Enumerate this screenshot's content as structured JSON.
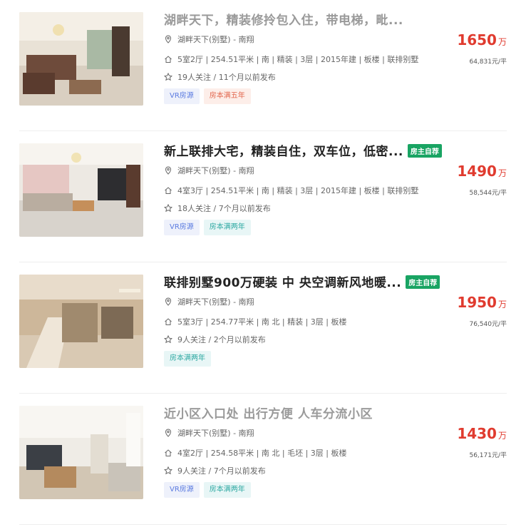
{
  "listings": [
    {
      "title": "湖畔天下，精装修拎包入住，带电梯，毗...",
      "owner_badge": "",
      "location": "湖畔天下(别墅) - 南翔",
      "info": "5室2厅 | 254.51平米 | 南 | 精装 | 3层 | 2015年建 | 板楼 | 联排别墅",
      "follow": "19人关注 / 11个月以前发布",
      "tags": [
        {
          "label": "VR房源",
          "kind": "vr"
        },
        {
          "label": "房本满五年",
          "kind": "five"
        }
      ],
      "total_price": "1650",
      "total_unit": "万",
      "unit_price": "64,831元/平"
    },
    {
      "title": "新上联排大宅，精装自住，双车位，低密...",
      "owner_badge": "房主自荐",
      "location": "湖畔天下(别墅) - 南翔",
      "info": "4室3厅 | 254.51平米 | 南 | 精装 | 3层 | 2015年建 | 板楼 | 联排别墅",
      "follow": "18人关注 / 7个月以前发布",
      "tags": [
        {
          "label": "VR房源",
          "kind": "vr"
        },
        {
          "label": "房本满两年",
          "kind": "two"
        }
      ],
      "total_price": "1490",
      "total_unit": "万",
      "unit_price": "58,544元/平"
    },
    {
      "title": "联排别墅900万硬装 中 央空调新风地暖...",
      "owner_badge": "房主自荐",
      "location": "湖畔天下(别墅) - 南翔",
      "info": "5室3厅 | 254.77平米 | 南 北 | 精装 | 3层 | 板楼",
      "follow": "9人关注 / 2个月以前发布",
      "tags": [
        {
          "label": "房本满两年",
          "kind": "two"
        }
      ],
      "total_price": "1950",
      "total_unit": "万",
      "unit_price": "76,540元/平"
    },
    {
      "title": "近小区入口处 出行方便 人车分流小区",
      "owner_badge": "",
      "location": "湖畔天下(别墅) - 南翔",
      "info": "4室2厅 | 254.58平米 | 南 北 | 毛坯 | 3层 | 板楼",
      "follow": "9人关注 / 7个月以前发布",
      "tags": [
        {
          "label": "VR房源",
          "kind": "vr"
        },
        {
          "label": "房本满两年",
          "kind": "two"
        }
      ],
      "total_price": "1430",
      "total_unit": "万",
      "unit_price": "56,171元/平"
    }
  ],
  "icons": {
    "location": "map-pin-icon",
    "info": "house-icon",
    "follow": "star-icon"
  },
  "colors": {
    "price": "#e03b2f",
    "owner_badge": "#19a463",
    "vr_tag": "#5b7be0",
    "five_tag": "#e2684f",
    "two_tag": "#2fa9a3"
  }
}
